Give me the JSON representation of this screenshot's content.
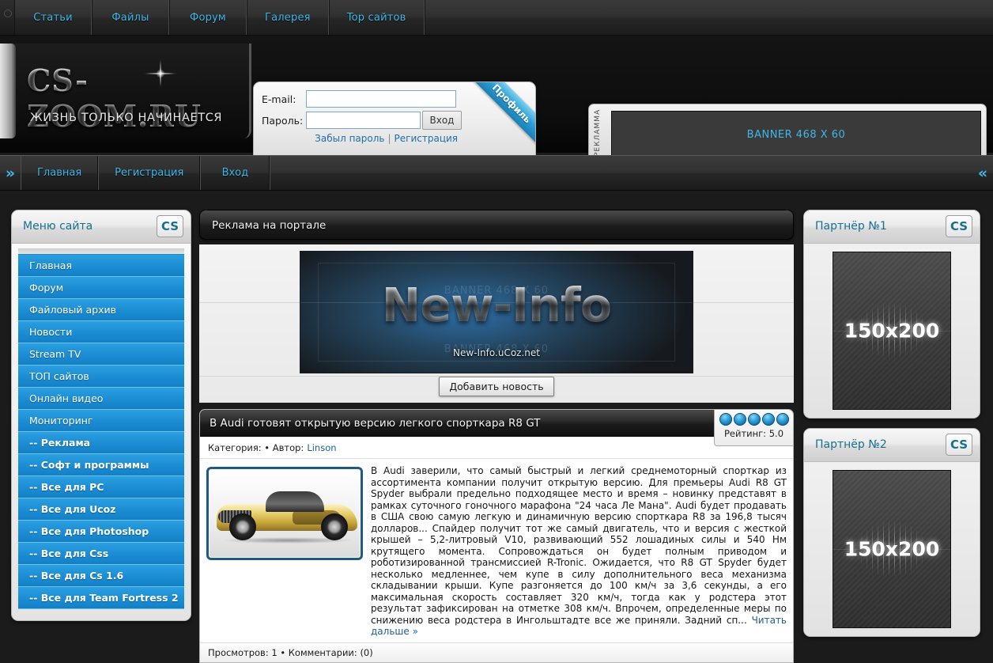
{
  "topnav": {
    "items": [
      {
        "label": "Статьи"
      },
      {
        "label": "Файлы"
      },
      {
        "label": "Форум"
      },
      {
        "label": "Галерея"
      },
      {
        "label": "Top сайтов"
      }
    ]
  },
  "header": {
    "logo_title": "CS-ZOOM.RU",
    "logo_slogan": "ЖИЗНЬ ТОЛЬКО НАЧИНАЕТСЯ",
    "login": {
      "email_label": "E-mail:",
      "email_value": "",
      "password_label": "Пароль:",
      "password_value": "",
      "submit_label": "Вход",
      "forgot_label": "Забыл пароль",
      "separator": "|",
      "register_label": "Регистрация",
      "ribbon_label": "Профиль"
    },
    "banner": {
      "vertical_label": "РЕКЛАММА",
      "placeholder_text": "BANNER 468 X 60"
    }
  },
  "subnav": {
    "left_arrow": "»",
    "right_arrow": "«",
    "items": [
      {
        "label": "Главная"
      },
      {
        "label": "Регистрация"
      },
      {
        "label": "Вход"
      }
    ]
  },
  "sidebar_left": {
    "title": "Меню сайта",
    "badge": "CS",
    "items": [
      {
        "label": "Главная",
        "sub": false
      },
      {
        "label": "Форум",
        "sub": false
      },
      {
        "label": "Файловый архив",
        "sub": false
      },
      {
        "label": "Новости",
        "sub": false
      },
      {
        "label": "Stream TV",
        "sub": false
      },
      {
        "label": "ТОП сайтов",
        "sub": false
      },
      {
        "label": "Онлайн видео",
        "sub": false
      },
      {
        "label": "Мониторинг",
        "sub": false
      },
      {
        "label": "-- Реклама",
        "sub": true
      },
      {
        "label": "-- Софт и программы",
        "sub": true
      },
      {
        "label": "-- Все для PC",
        "sub": true
      },
      {
        "label": "-- Все для Ucoz",
        "sub": true
      },
      {
        "label": "-- Все для Photoshop",
        "sub": true
      },
      {
        "label": "-- Все для Css",
        "sub": true
      },
      {
        "label": "-- Все для Cs 1.6",
        "sub": true
      },
      {
        "label": "-- Все для Team Fortress 2",
        "sub": true
      }
    ]
  },
  "center": {
    "header_title": "Реклама на портале",
    "advert": {
      "title": "New-Info",
      "subtitle": "New-Info.uCoz.net",
      "ghost_text": "BANNER 468 X 60"
    },
    "add_news_label": "Добавить новость",
    "post": {
      "title": "В Audi готовят открытую версию легкого спорткара R8 GT",
      "rating_value": "Рейтинг: 5.0",
      "rating_dots": 5,
      "category_label": "Категория:",
      "category_value": "•",
      "author_label": "Автор:",
      "author_name": "Linson",
      "body": "В Audi заверили, что самый быстрый и легкий среднемоторный спорткар из ассортимента компании получит открытую версию. Для премьеры Audi R8 GT Spyder выбрали предельно подходящее место и время – новинку представят в рамках суточного гоночного марафона \"24 часа Ле Мана\". Audi будет продавать в США свою самую легкую и динамичную версию спорткара R8 за 196,8 тысяч долларов... Спайдер получит тот же самый двигатель, что и версия с жесткой крышей – 5,2-литровый V10, развивающий 552 лошадиных силы и 540 Нм крутящего момента. Сопровождаться он будет полным приводом и роботизированной трансмиссией R-Tronic. Ожидается, что R8 GT Spyder будет несколько медленнее, чем купе в силу дополнительного веса механизма складывании крыши. Купе разгоняется до 100 км/ч за 3,6 секунды, а его максимальная скорость составляет 320 км/ч, тогда как у родстера этот результат зафиксирован на отметке 308 км/ч. Впрочем, определенные меры по снижению веса родстера в Ингольштадте все же приняли. Задний сп...",
      "read_more_label": "Читать дальше »",
      "footer": "Просмотров: 1 • Комментарии: (0)"
    }
  },
  "sidebar_right": {
    "partners": [
      {
        "title": "Партнёр №1",
        "badge": "CS",
        "placeholder": "150x200"
      },
      {
        "title": "Партнёр №2",
        "badge": "CS",
        "placeholder": "150x200"
      }
    ]
  },
  "colors": {
    "accent_cyan": "#3fb8e8",
    "menu_blue": "#1d8ed4",
    "title_teal": "#18708f",
    "link_blue": "#1f6fa8"
  }
}
